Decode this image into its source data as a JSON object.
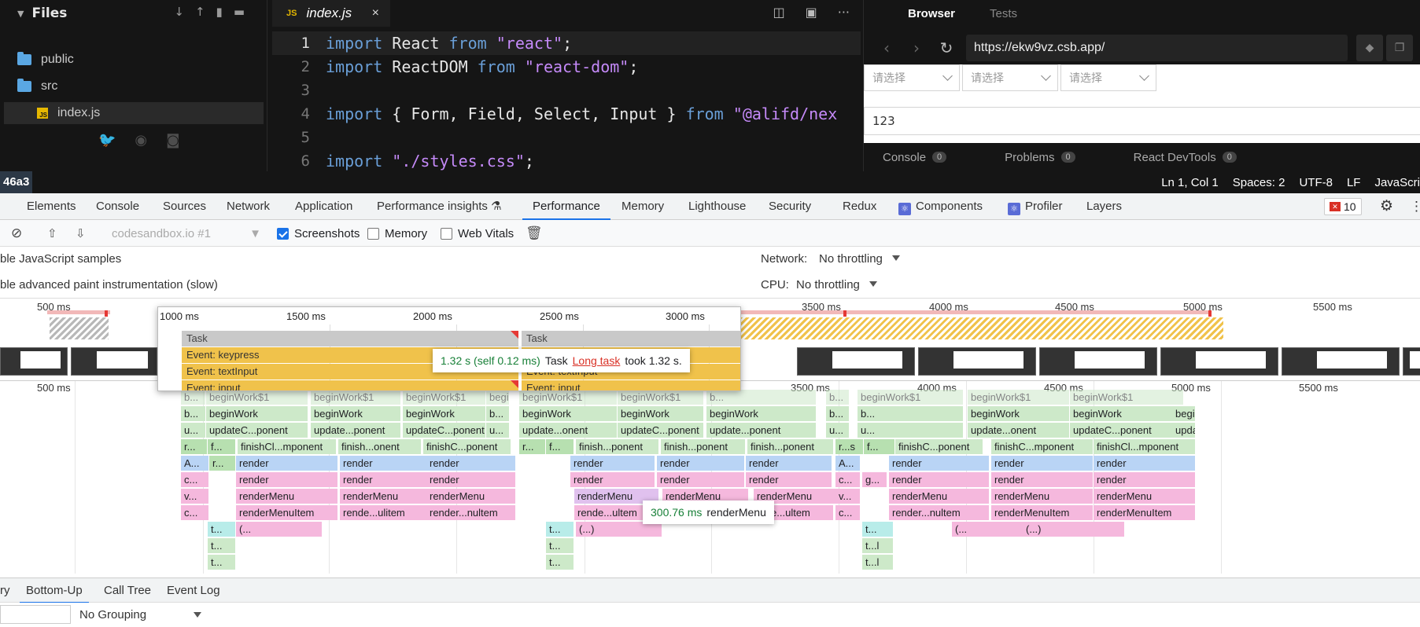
{
  "files": {
    "title": "Files",
    "items": [
      {
        "label": "public",
        "type": "folder"
      },
      {
        "label": "src",
        "type": "folder"
      },
      {
        "label": "index.js",
        "type": "file"
      }
    ],
    "icons": [
      "arrow-down-icon",
      "arrow-up-icon",
      "new-file-icon",
      "new-folder-icon"
    ],
    "social": [
      "twitter-icon",
      "github-icon",
      "discord-icon"
    ]
  },
  "editor": {
    "tab_label": "index.js",
    "tab_badge": "JS",
    "close": "×",
    "lines": [
      {
        "n": "1",
        "parts": [
          [
            "kw",
            "import"
          ],
          [
            "plain",
            " React "
          ],
          [
            "kw",
            "from"
          ],
          [
            "plain",
            " "
          ],
          [
            "str",
            "\"react\""
          ],
          [
            "plain",
            ";"
          ]
        ]
      },
      {
        "n": "2",
        "parts": [
          [
            "kw",
            "import"
          ],
          [
            "plain",
            " ReactDOM "
          ],
          [
            "kw",
            "from"
          ],
          [
            "plain",
            " "
          ],
          [
            "str",
            "\"react-dom\""
          ],
          [
            "plain",
            ";"
          ]
        ]
      },
      {
        "n": "3",
        "parts": []
      },
      {
        "n": "4",
        "parts": [
          [
            "kw",
            "import"
          ],
          [
            "plain",
            " { Form, Field, Select, Input } "
          ],
          [
            "kw",
            "from"
          ],
          [
            "plain",
            " "
          ],
          [
            "str",
            "\"@alifd/nex"
          ]
        ]
      },
      {
        "n": "5",
        "parts": []
      },
      {
        "n": "6",
        "parts": [
          [
            "kw",
            "import"
          ],
          [
            "plain",
            " "
          ],
          [
            "str",
            "\"./styles.css\""
          ],
          [
            "plain",
            ";"
          ]
        ]
      }
    ]
  },
  "browser": {
    "tabs": [
      "Browser",
      "Tests"
    ],
    "url": "https://ekw9vz.csb.app/",
    "selects": [
      "请选择",
      "请选择",
      "请选择"
    ],
    "input_value": "123",
    "bottom": [
      {
        "label": "Console",
        "count": "0"
      },
      {
        "label": "Problems",
        "count": "0"
      },
      {
        "label": "React DevTools",
        "count": "0"
      }
    ]
  },
  "statusbar": {
    "hash": "46a3",
    "position": "Ln 1, Col 1",
    "spaces": "Spaces: 2",
    "encoding": "UTF-8",
    "eol": "LF",
    "language": "JavaScri"
  },
  "devtools": {
    "tabs": [
      "Elements",
      "Console",
      "Sources",
      "Network",
      "Application",
      "Performance insights",
      "Performance",
      "Memory",
      "Lighthouse",
      "Security",
      "Redux",
      "Components",
      "Profiler",
      "Layers"
    ],
    "active_tab": "Performance",
    "error_count": "10",
    "toolbar": {
      "profile_select": "codesandbox.io #1",
      "screenshots": "Screenshots",
      "memory": "Memory",
      "web_vitals": "Web Vitals"
    },
    "settings": {
      "js_samples": "ble JavaScript samples",
      "paint": "ble advanced paint instrumentation (slow)",
      "network_label": "Network:",
      "network_value": "No throttling",
      "cpu_label": "CPU:",
      "cpu_value": "No throttling"
    }
  },
  "overview": {
    "ticks": [
      "500 ms",
      "1000 ms",
      "1500 ms",
      "2000 ms",
      "2500 ms",
      "3000 ms",
      "3500 ms",
      "4000 ms",
      "4500 ms",
      "5000 ms",
      "5500 ms"
    ]
  },
  "zoom": {
    "ticks": [
      "1000 ms",
      "1500 ms",
      "2000 ms",
      "2500 ms",
      "3000 ms"
    ],
    "rows": [
      [
        "Task",
        "Task"
      ],
      [
        "Event: keypress",
        "Event: keypress"
      ],
      [
        "Event: textInput",
        "Event: textInput"
      ],
      [
        "Event: input",
        "Event: input"
      ]
    ]
  },
  "flame": {
    "ticks": [
      "500 ms",
      "3500 ms",
      "4000 ms",
      "4500 ms",
      "5000 ms",
      "5500 ms"
    ],
    "rows": [
      [
        [
          "b...",
          "g"
        ],
        [
          "beginWork$1",
          "g"
        ],
        [
          "beginWork$1",
          "g"
        ],
        [
          "beginWork$1",
          "g"
        ],
        [
          "beginWork$1",
          "g"
        ],
        [
          "beginWork$1",
          "g"
        ],
        [
          "beginWork$1",
          "g"
        ],
        [
          "b...",
          "g"
        ],
        [
          "b...",
          "g"
        ],
        [
          "beginWork$1",
          "g"
        ],
        [
          "beginWork$1",
          "g"
        ],
        [
          "beginWork$1",
          "g"
        ]
      ],
      [
        [
          "b...",
          "g"
        ],
        [
          "beginWork",
          "g"
        ],
        [
          "beginWork",
          "g"
        ],
        [
          "beginWork",
          "g"
        ],
        [
          "b...",
          "g"
        ],
        [
          "beginWork",
          "g"
        ],
        [
          "beginWork",
          "g"
        ],
        [
          "beginWork",
          "g"
        ],
        [
          "b...",
          "g"
        ],
        [
          "b...",
          "g"
        ],
        [
          "beginWork",
          "g"
        ],
        [
          "beginWork",
          "g"
        ],
        [
          "beginWork",
          "g"
        ]
      ],
      [
        [
          "u...",
          "g"
        ],
        [
          "updateC...ponent",
          "g"
        ],
        [
          "update...ponent",
          "g"
        ],
        [
          "updateC...ponent",
          "g"
        ],
        [
          "u...",
          "g"
        ],
        [
          "update...onent",
          "g"
        ],
        [
          "updateC...ponent",
          "g"
        ],
        [
          "update...ponent",
          "g"
        ],
        [
          "u...",
          "g"
        ],
        [
          "u...",
          "g"
        ],
        [
          "update...onent",
          "g"
        ],
        [
          "updateC...ponent",
          "g"
        ],
        [
          "updateC...ponent",
          "g"
        ]
      ],
      [
        [
          "r...",
          "gd"
        ],
        [
          "f...",
          "gd"
        ],
        [
          "finishCl...mponent",
          "g"
        ],
        [
          "finish...onent",
          "g"
        ],
        [
          "finishC...ponent",
          "g"
        ],
        [
          "r...",
          "gd"
        ],
        [
          "f...",
          "gd"
        ],
        [
          "finish...ponent",
          "g"
        ],
        [
          "finish...ponent",
          "g"
        ],
        [
          "finish...ponent",
          "g"
        ],
        [
          "r...s",
          "gd"
        ],
        [
          "f...",
          "gd"
        ],
        [
          "finishC...ponent",
          "g"
        ],
        [
          "finishC...mponent",
          "g"
        ],
        [
          "finishCl...mponent",
          "g"
        ]
      ],
      [
        [
          "A...",
          "bl"
        ],
        [
          "r...",
          "gd"
        ],
        [
          "render",
          "bl"
        ],
        [
          "render",
          "bl"
        ],
        [
          "render",
          "bl"
        ],
        [
          "render",
          "bl"
        ],
        [
          "render",
          "bl"
        ],
        [
          "render",
          "bl"
        ],
        [
          "A...",
          "bl"
        ],
        [
          "render",
          "bl"
        ],
        [
          "render",
          "bl"
        ],
        [
          "render",
          "bl"
        ]
      ],
      [
        [
          "c...",
          "pk"
        ],
        [
          "render",
          "pk"
        ],
        [
          "render",
          "pk"
        ],
        [
          "render",
          "pk"
        ],
        [
          "render",
          "pk"
        ],
        [
          "render",
          "pk"
        ],
        [
          "render",
          "pk"
        ],
        [
          "c...",
          "pk"
        ],
        [
          "g...",
          "pk"
        ],
        [
          "render",
          "pk"
        ],
        [
          "render",
          "pk"
        ],
        [
          "render",
          "pk"
        ]
      ],
      [
        [
          "v...",
          "pk"
        ],
        [
          "renderMenu",
          "pk"
        ],
        [
          "renderMenu",
          "pk"
        ],
        [
          "renderMenu",
          "pk"
        ],
        [
          "renderMenu",
          "pu"
        ],
        [
          "renderMenu",
          "pk"
        ],
        [
          "renderMenu",
          "pk"
        ],
        [
          "v...",
          "pk"
        ],
        [
          "renderMenu",
          "pk"
        ],
        [
          "renderMenu",
          "pk"
        ],
        [
          "renderMenu",
          "pk"
        ]
      ],
      [
        [
          "c...",
          "pk"
        ],
        [
          "renderMenuItem",
          "pk"
        ],
        [
          "rende...ulitem",
          "pk"
        ],
        [
          "render...nultem",
          "pk"
        ],
        [
          "rende...ultem",
          "pk"
        ],
        [
          "rende...ultem",
          "pk"
        ],
        [
          "c...",
          "pk"
        ],
        [
          "render...nultem",
          "pk"
        ],
        [
          "renderMenuItem",
          "pk"
        ],
        [
          "renderMenuItem",
          "pk"
        ]
      ],
      [
        [
          "t...",
          "cy"
        ],
        [
          "(...",
          "pk"
        ],
        [
          "t...",
          "cy"
        ],
        [
          "(...)",
          "pk"
        ],
        [
          "t...",
          "cy"
        ],
        [
          "(...",
          "pk"
        ],
        [
          "(...)",
          "pk"
        ]
      ],
      [
        [
          "t...",
          "g"
        ],
        [
          "t...",
          "g"
        ],
        [
          "t...l",
          "g"
        ]
      ],
      [
        [
          "t...",
          "g"
        ],
        [
          "t...",
          "g"
        ],
        [
          "t...l",
          "g"
        ]
      ]
    ]
  },
  "tooltips": {
    "task_time": "1.32 s (self 0.12 ms)",
    "task_name": "Task",
    "task_link": "Long task",
    "task_suffix": "took 1.32 s.",
    "menu_time": "300.76 ms",
    "menu_name": "renderMenu"
  },
  "bottom": {
    "tabs": [
      "ry",
      "Bottom-Up",
      "Call Tree",
      "Event Log"
    ],
    "active": "Bottom-Up",
    "grouping": "No Grouping"
  },
  "colors": {
    "accent": "#1a73e8",
    "task_yellow": "#f0c24b",
    "error_red": "#d93025"
  }
}
